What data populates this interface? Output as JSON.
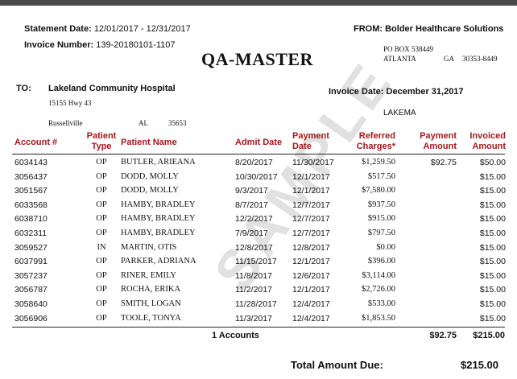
{
  "statement": {
    "statement_date_label": "Statement Date:",
    "statement_date": "12/01/2017 - 12/31/2017",
    "invoice_number_label": "Invoice Number:",
    "invoice_number": "139-20180101-1107"
  },
  "logo_text": "QA-MASTER",
  "from": {
    "label": "FROM:",
    "name": "Bolder Healthcare Solutions",
    "po_box": "PO BOX 538449",
    "city": "ATLANTA",
    "state": "GA",
    "zip": "30353-8449"
  },
  "to": {
    "label": "TO:",
    "name": "Lakeland Community Hospital",
    "street": "15155 Hwy 43",
    "city": "Russellville",
    "state": "AL",
    "zip": "35653"
  },
  "invoice_date_label": "Invoice Date:",
  "invoice_date": "December 31,2017",
  "facility_code": "LAKEMA",
  "table": {
    "headers": {
      "account": "Account #",
      "patient_type_1": "Patient",
      "patient_type_2": "Type",
      "patient_name": "Patient Name",
      "admit_date": "Admit Date",
      "payment_date_1": "Payment",
      "payment_date_2": "Date",
      "referred_1": "Referred",
      "referred_2": "Charges*",
      "payment_amount_1": "Payment",
      "payment_amount_2": "Amount",
      "invoiced_1": "Invoiced",
      "invoiced_2": "Amount"
    },
    "rows": [
      {
        "account": "6034143",
        "type": "OP",
        "name": "BUTLER, ARIEANA",
        "admit": "8/20/2017",
        "pay_date": "11/30/2017",
        "referred": "$1,259.50",
        "pay_amt": "$92.75",
        "invoiced": "$50.00"
      },
      {
        "account": "3056437",
        "type": "OP",
        "name": "DODD, MOLLY",
        "admit": "10/30/2017",
        "pay_date": "12/1/2017",
        "referred": "$517.50",
        "pay_amt": "",
        "invoiced": "$15.00"
      },
      {
        "account": "3051567",
        "type": "OP",
        "name": "DODD, MOLLY",
        "admit": "9/3/2017",
        "pay_date": "12/1/2017",
        "referred": "$7,580.00",
        "pay_amt": "",
        "invoiced": "$15.00"
      },
      {
        "account": "6033568",
        "type": "OP",
        "name": "HAMBY, BRADLEY",
        "admit": "8/7/2017",
        "pay_date": "12/7/2017",
        "referred": "$937.50",
        "pay_amt": "",
        "invoiced": "$15.00"
      },
      {
        "account": "6038710",
        "type": "OP",
        "name": "HAMBY, BRADLEY",
        "admit": "12/2/2017",
        "pay_date": "12/7/2017",
        "referred": "$915.00",
        "pay_amt": "",
        "invoiced": "$15.00"
      },
      {
        "account": "6032311",
        "type": "OP",
        "name": "HAMBY, BRADLEY",
        "admit": "7/9/2017",
        "pay_date": "12/7/2017",
        "referred": "$797.50",
        "pay_amt": "",
        "invoiced": "$15.00"
      },
      {
        "account": "3059527",
        "type": "IN",
        "name": "MARTIN, OTIS",
        "admit": "12/8/2017",
        "pay_date": "12/8/2017",
        "referred": "$0.00",
        "pay_amt": "",
        "invoiced": "$15.00"
      },
      {
        "account": "6037991",
        "type": "OP",
        "name": "PARKER, ADRIANA",
        "admit": "11/15/2017",
        "pay_date": "12/1/2017",
        "referred": "$396.00",
        "pay_amt": "",
        "invoiced": "$15.00"
      },
      {
        "account": "3057237",
        "type": "OP",
        "name": "RINER, EMILY",
        "admit": "11/8/2017",
        "pay_date": "12/6/2017",
        "referred": "$3,114.00",
        "pay_amt": "",
        "invoiced": "$15.00"
      },
      {
        "account": "3056787",
        "type": "OP",
        "name": "ROCHA, ERIKA",
        "admit": "11/2/2017",
        "pay_date": "12/1/2017",
        "referred": "$2,726.00",
        "pay_amt": "",
        "invoiced": "$15.00"
      },
      {
        "account": "3058640",
        "type": "OP",
        "name": "SMITH, LOGAN",
        "admit": "11/28/2017",
        "pay_date": "12/4/2017",
        "referred": "$533.00",
        "pay_amt": "",
        "invoiced": "$15.00"
      },
      {
        "account": "3056906",
        "type": "OP",
        "name": "TOOLE, TONYA",
        "admit": "11/3/2017",
        "pay_date": "12/4/2017",
        "referred": "$1,853.50",
        "pay_amt": "",
        "invoiced": "$15.00"
      }
    ]
  },
  "totals": {
    "accounts": "1 Accounts",
    "payment_total": "$92.75",
    "invoiced_total": "$215.00"
  },
  "total_due_label": "Total Amount Due:",
  "total_due": "$215.00",
  "watermark": "SAMPLE"
}
